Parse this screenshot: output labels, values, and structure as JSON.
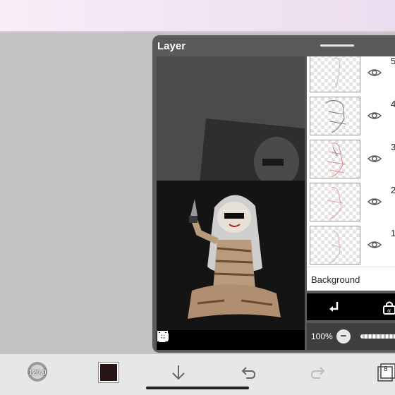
{
  "layer_panel": {
    "title": "Layer",
    "layers": [
      {
        "number": "5",
        "visible": true
      },
      {
        "number": "4",
        "visible": true
      },
      {
        "number": "3",
        "visible": true
      },
      {
        "number": "2",
        "visible": true
      },
      {
        "number": "1",
        "visible": true
      }
    ],
    "background_label": "Background",
    "opacity": "100%"
  },
  "bottom_toolbar": {
    "brush_size": "120.0",
    "color": "#2a1414",
    "layer_count": "8"
  },
  "colors": {
    "accent_top": "#f2e6f3",
    "panel": "#5a5a5a"
  },
  "icons": [
    "add-layer-icon",
    "duplicate-layer-icon",
    "camera-icon",
    "flip-horizontal-icon",
    "flip-vertical-icon",
    "merge-down-icon",
    "alpha-lock-icon",
    "undo-icon",
    "redo-icon",
    "download-icon",
    "eye-icon"
  ]
}
